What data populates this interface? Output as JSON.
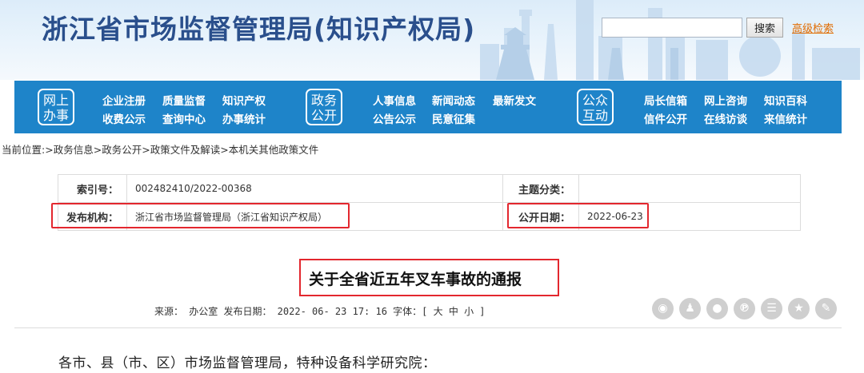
{
  "header": {
    "site_title": "浙江省市场监督管理局(知识产权局)",
    "search": {
      "value": "",
      "button_label": "搜索",
      "advanced_label": "高级检索"
    }
  },
  "nav": {
    "groups": [
      {
        "badge": [
          "网上",
          "办事"
        ],
        "links": [
          [
            "企业注册",
            "质量监督",
            "知识产权"
          ],
          [
            "收费公示",
            "查询中心",
            "办事统计"
          ]
        ]
      },
      {
        "badge": [
          "政务",
          "公开"
        ],
        "links": [
          [
            "人事信息",
            "新闻动态",
            "最新发文"
          ],
          [
            "公告公示",
            "民意征集"
          ]
        ]
      },
      {
        "badge": [
          "公众",
          "互动"
        ],
        "links": [
          [
            "局长信箱",
            "网上咨询",
            "知识百科"
          ],
          [
            "信件公开",
            "在线访谈",
            "来信统计"
          ]
        ]
      }
    ]
  },
  "breadcrumb": {
    "prefix": "当前位置:",
    "items": [
      "政务信息",
      "政务公开",
      "政策文件及解读",
      "本机关其他政策文件"
    ]
  },
  "meta": {
    "index_label": "索引号：",
    "index_value": "002482410/2022-00368",
    "topic_label": "主题分类：",
    "topic_value": "",
    "publisher_label": "发布机构：",
    "publisher_value": "浙江省市场监督管理局（浙江省知识产权局）",
    "date_label": "公开日期：",
    "date_value": "2022-06-23"
  },
  "article": {
    "title": "关于全省近五年叉车事故的通报",
    "info_line": "来源：  办公室 发布日期：  2022- 06- 23 17: 16 字体：[ 大 中 小 ]",
    "salutation": "各市、县（市、区）市场监督管理局，特种设备科学研究院："
  },
  "share": {
    "icons": [
      "weibo-icon",
      "qq-icon",
      "wechat-icon",
      "pinterest-icon",
      "douban-icon",
      "qzone-icon",
      "more-icon"
    ],
    "color": "#cfcfcf"
  },
  "colors": {
    "nav_blue": "#1e84c9",
    "title_blue": "#2a4f8c",
    "highlight_red": "#e3272e",
    "link_orange": "#e06b00"
  }
}
